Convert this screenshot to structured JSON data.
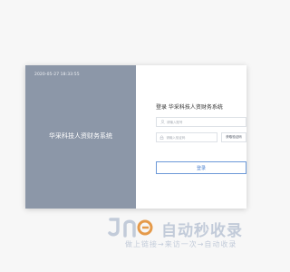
{
  "left_panel": {
    "datetime": "2020-05-27 18:33:55",
    "brand_title": "华采科技人资财务系统"
  },
  "login": {
    "title": "登录 华采科技人资财务系统",
    "username_placeholder": "请输入账号",
    "code_placeholder": "请输入验证码",
    "code_button_label": "获取验证码",
    "submit_label": "登录"
  },
  "watermark": {
    "name": "自动秒收录",
    "slogan": "做上链接→来访一次→自动收录"
  },
  "colors": {
    "panel_bg": "#8c97a8",
    "accent": "#4a7fcf",
    "watermark": "#c2cbd9"
  },
  "icons": {
    "username_field": "user-icon",
    "code_field": "lock-icon"
  }
}
